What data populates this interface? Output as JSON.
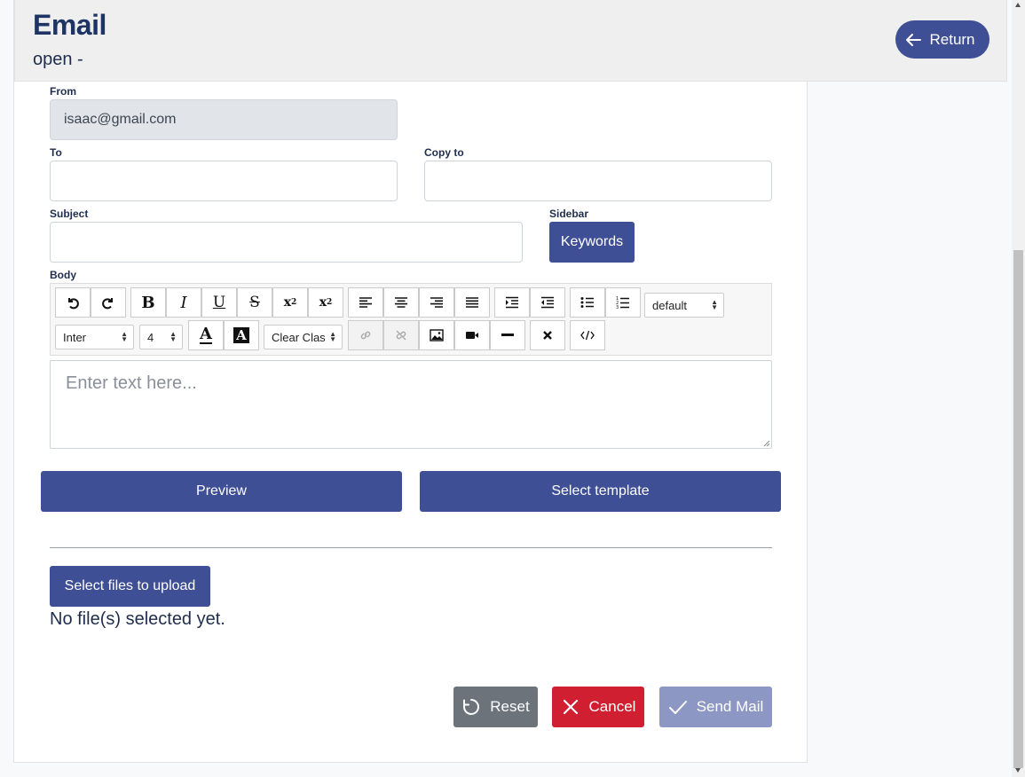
{
  "header": {
    "title": "Email",
    "subtitle": "open -",
    "return_label": "Return"
  },
  "form": {
    "from_label": "From",
    "from_value": "isaac@gmail.com",
    "to_label": "To",
    "to_value": "",
    "copy_label": "Copy to",
    "copy_value": "",
    "subject_label": "Subject",
    "subject_value": "",
    "sidebar_label": "Sidebar",
    "keywords_label": "Keywords",
    "body_label": "Body",
    "body_placeholder": "Enter text here..."
  },
  "toolbar": {
    "paragraph_select": "default",
    "font_select": "Inter",
    "size_select": "4",
    "class_select": "Clear Clas"
  },
  "buttons": {
    "preview": "Preview",
    "select_template": "Select template",
    "select_files": "Select files to upload",
    "no_files": "No file(s) selected yet.",
    "reset": "Reset",
    "cancel": "Cancel",
    "send": "Send Mail"
  },
  "colors": {
    "primary": "#3f4f96",
    "danger": "#d01f31",
    "secondary": "#6c737b",
    "send_disabled": "#8d97c4"
  }
}
